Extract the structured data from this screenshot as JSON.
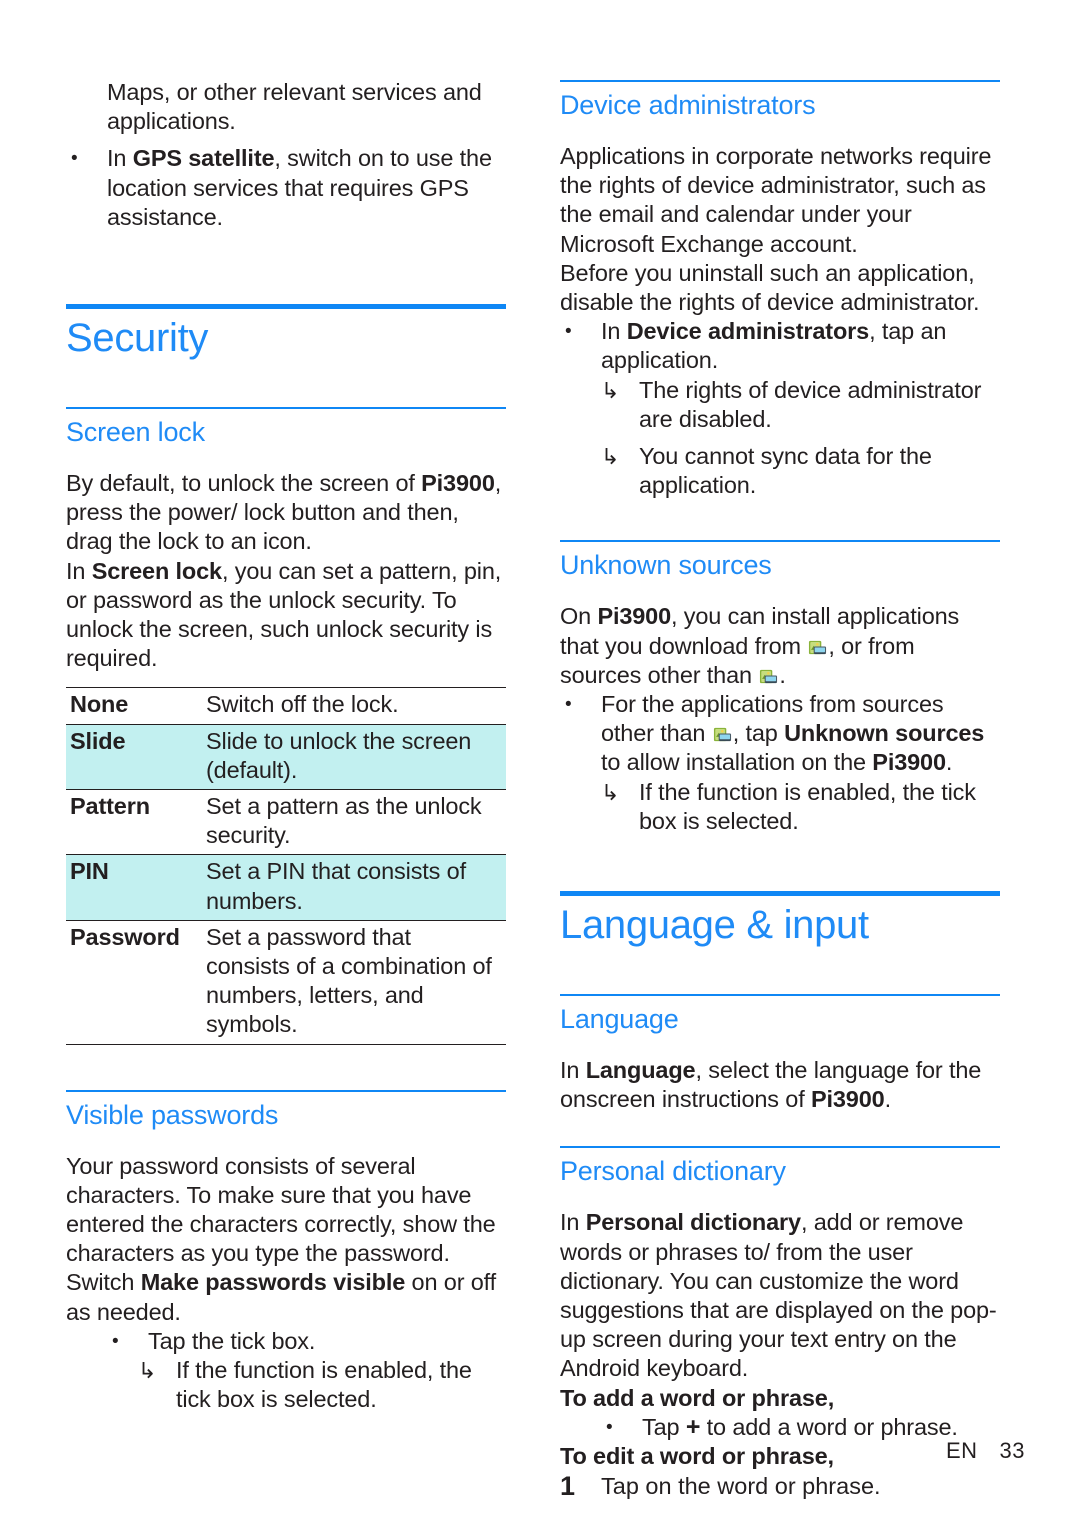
{
  "page": {
    "footer_language": "EN",
    "footer_page_number": "33",
    "accent_color": "#1f8bf6",
    "rule_color": "#0f87f5",
    "highlight_color": "#c2f0f0",
    "text_color": "#231f20"
  },
  "left_column": {
    "continued_paragraph": "Maps, or other relevant services and applications.",
    "gps_bullet": {
      "marker": "•",
      "prefix": "In ",
      "bold": "GPS satellite",
      "suffix": ", switch on to use the location services that requires GPS assistance."
    },
    "chapter": {
      "title": "Security"
    },
    "screen_lock": {
      "heading": "Screen lock",
      "paragraph_1_prefix": "By default, to unlock the screen of ",
      "paragraph_1_bold": "Pi3900",
      "paragraph_1_suffix": ", press the power/ lock button and then, drag the lock to an icon.",
      "paragraph_2_prefix": "In ",
      "paragraph_2_bold": "Screen lock",
      "paragraph_2_suffix": ", you can set a pattern, pin, or password as the unlock security. To unlock the screen, such unlock security is required.",
      "table": {
        "rows": [
          {
            "option": "None",
            "description": "Switch off the lock.",
            "highlighted": false
          },
          {
            "option": "Slide",
            "description": "Slide to unlock the screen (default).",
            "highlighted": true
          },
          {
            "option": "Pattern",
            "description": "Set a pattern as the unlock security.",
            "highlighted": false
          },
          {
            "option": "PIN",
            "description": "Set a PIN that consists of numbers.",
            "highlighted": true
          },
          {
            "option": "Password",
            "description": "Set a password that consists of a combination of numbers, letters, and symbols.",
            "highlighted": false
          }
        ]
      }
    },
    "visible_passwords": {
      "heading": "Visible passwords",
      "paragraph_prefix": "Your password consists of several characters. To make sure that you have entered the characters correctly, show the characters as you type the password. Switch ",
      "paragraph_bold": "Make passwords visible",
      "paragraph_suffix": " on or off as needed.",
      "bullet": {
        "marker": "•",
        "text": "Tap the tick box."
      },
      "sub_bullet": {
        "marker": "↳",
        "text": "If the function is enabled, the tick box is selected."
      }
    }
  },
  "right_column": {
    "device_administrators": {
      "heading": "Device administrators",
      "paragraph_1": "Applications in corporate networks require the rights of device administrator, such as the email and calendar under your Microsoft Exchange account.",
      "paragraph_2": "Before you uninstall such an application, disable the rights of device administrator.",
      "bullet": {
        "marker": "•",
        "prefix": "In ",
        "bold": "Device administrators",
        "suffix": ", tap an application."
      },
      "sub_bullets": [
        {
          "marker": "↳",
          "text": "The rights of device administrator are disabled."
        },
        {
          "marker": "↳",
          "text": "You cannot sync data for the application."
        }
      ]
    },
    "unknown_sources": {
      "heading": "Unknown sources",
      "paragraph_prefix": "On ",
      "paragraph_bold": "Pi3900",
      "paragraph_mid_1": ", you can install applications that you download from ",
      "icon_name": "market-store-icon",
      "paragraph_mid_2": ", or from sources other than ",
      "paragraph_suffix": ".",
      "bullet": {
        "marker": "•",
        "text_1": "For the applications from sources other than ",
        "text_2": ", tap ",
        "bold": "Unknown sources",
        "text_3": " to allow installation on the ",
        "bold_2": "Pi3900",
        "text_4": "."
      },
      "sub_bullet": {
        "marker": "↳",
        "text": "If the function is enabled, the tick box is selected."
      }
    },
    "chapter": {
      "title": "Language & input"
    },
    "language": {
      "heading": "Language",
      "paragraph_prefix": "In ",
      "paragraph_bold": "Language",
      "paragraph_mid": ", select the language for the onscreen instructions of ",
      "paragraph_bold_2": "Pi3900",
      "paragraph_suffix": "."
    },
    "personal_dictionary": {
      "heading": "Personal dictionary",
      "paragraph_prefix": "In ",
      "paragraph_bold": "Personal dictionary",
      "paragraph_suffix": ", add or remove words or phrases to/ from the user dictionary. You can customize the word suggestions that are displayed on the pop-up screen during your text entry on the Android keyboard.",
      "add_heading": "To add a word or phrase,",
      "add_bullet": {
        "marker": "•",
        "prefix": "Tap ",
        "icon": "+",
        "suffix": " to add a word or phrase."
      },
      "edit_heading": "To edit a word or phrase,",
      "edit_step": {
        "number": "1",
        "text": "Tap on the word or phrase."
      }
    }
  }
}
